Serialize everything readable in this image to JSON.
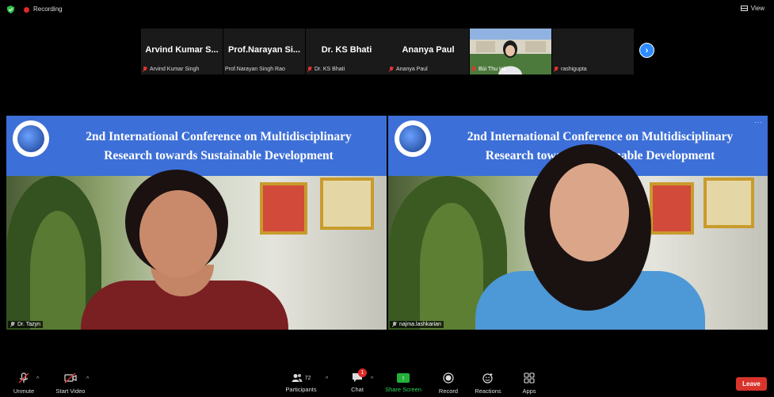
{
  "topbar": {
    "recording_label": "Recording",
    "view_label": "View"
  },
  "strip": {
    "participants": [
      {
        "display_name": "Arvind Kumar S...",
        "full_name": "Arvind Kumar Singh"
      },
      {
        "display_name": "Prof.Narayan Si...",
        "full_name": "Prof.Narayan Singh Rao"
      },
      {
        "display_name": "Dr. KS Bhati",
        "full_name": "Dr. KS Bhati"
      },
      {
        "display_name": "Ananya Paul",
        "full_name": "Ananya Paul"
      },
      {
        "display_name": "",
        "full_name": "Bùi Thu Hà"
      },
      {
        "display_name": "",
        "full_name": "rashigupta"
      }
    ],
    "next_icon": "chevron-right-icon"
  },
  "banner": {
    "line1": "2nd International Conference on Multidisciplinary",
    "line2": "Research towards Sustainable Development"
  },
  "tiles": {
    "left": {
      "name": "Dr. Tazyn"
    },
    "right": {
      "name": "najma.lashkarian",
      "more": "···"
    }
  },
  "toolbar": {
    "unmute": "Unmute",
    "start_video": "Start Video",
    "participants": "Participants",
    "participants_count": "72",
    "chat": "Chat",
    "chat_badge": "1",
    "share_screen": "Share Screen",
    "record": "Record",
    "reactions": "Reactions",
    "apps": "Apps",
    "leave": "Leave"
  }
}
